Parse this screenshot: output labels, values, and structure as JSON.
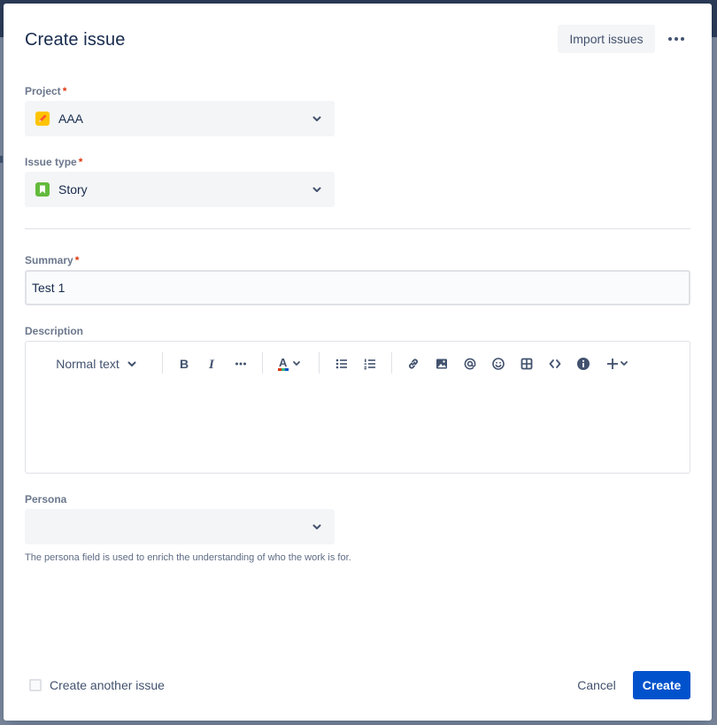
{
  "dialog": {
    "title": "Create issue",
    "import_label": "Import issues",
    "more_icon": "more-horizontal-icon"
  },
  "project": {
    "label": "Project",
    "required_mark": "*",
    "value": "AAA",
    "icon": "project-pencil-icon",
    "icon_color": "#ffc400"
  },
  "issue_type": {
    "label": "Issue type",
    "required_mark": "*",
    "value": "Story",
    "icon": "story-bookmark-icon",
    "icon_color": "#63ba3c"
  },
  "summary": {
    "label": "Summary",
    "required_mark": "*",
    "value": "Test 1"
  },
  "description": {
    "label": "Description",
    "toolbar": {
      "text_style": "Normal text",
      "tools": [
        "bold-icon",
        "italic-icon",
        "more-formatting-icon",
        "text-color-icon",
        "bullet-list-icon",
        "numbered-list-icon",
        "link-icon",
        "image-icon",
        "mention-icon",
        "emoji-icon",
        "table-icon",
        "code-icon",
        "info-panel-icon",
        "insert-plus-icon"
      ]
    }
  },
  "persona": {
    "label": "Persona",
    "value": "",
    "help_text": "The persona field is used to enrich the understanding of who the work is for."
  },
  "footer": {
    "create_another_label": "Create another issue",
    "create_another_checked": false,
    "cancel_label": "Cancel",
    "create_label": "Create"
  },
  "colors": {
    "primary": "#0052cc",
    "required": "#de350b",
    "field_bg": "#f4f5f7"
  }
}
